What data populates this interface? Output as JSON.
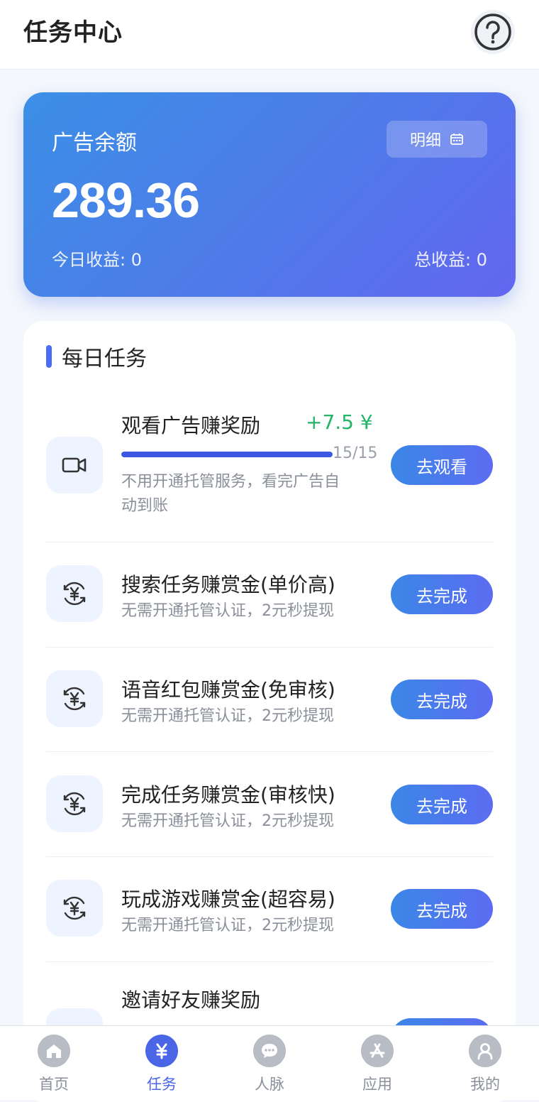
{
  "header": {
    "title": "任务中心"
  },
  "balance": {
    "label": "广告余额",
    "detail_label": "明细",
    "amount": "289.36",
    "today_income": "今日收益: 0",
    "total_income": "总收益: 0"
  },
  "daily": {
    "title": "每日任务",
    "ad_task": {
      "title": "观看广告赚奖励",
      "reward": "+7.5 ¥",
      "progress_text": "15/15",
      "progress_fraction": 1.0,
      "desc_line1": "不用开通托管服务，看完广告自",
      "desc_line2": "动到账",
      "button": "去观看"
    },
    "tasks": [
      {
        "title": "搜索任务赚赏金(单价高)",
        "desc": "无需开通托管认证，2元秒提现",
        "button": "去完成"
      },
      {
        "title": "语音红包赚赏金(免审核)",
        "desc": "无需开通托管认证，2元秒提现",
        "button": "去完成"
      },
      {
        "title": "完成任务赚赏金(审核快)",
        "desc": "无需开通托管认证，2元秒提现",
        "button": "去完成"
      },
      {
        "title": "玩成游戏赚赏金(超容易)",
        "desc": "无需开通托管认证，2元秒提现",
        "button": "去完成"
      },
      {
        "title": "邀请好友赚奖励",
        "desc": "",
        "button": ""
      }
    ]
  },
  "tabbar": {
    "items": [
      {
        "label": "首页",
        "icon": "home-icon"
      },
      {
        "label": "任务",
        "icon": "yuan-icon"
      },
      {
        "label": "人脉",
        "icon": "chat-icon"
      },
      {
        "label": "应用",
        "icon": "app-store-icon"
      },
      {
        "label": "我的",
        "icon": "user-icon"
      }
    ]
  },
  "colors": {
    "accent": "#4a66e6",
    "reward_green": "#23b46a",
    "card_start": "#3b8fe6",
    "card_end": "#6366f1"
  }
}
